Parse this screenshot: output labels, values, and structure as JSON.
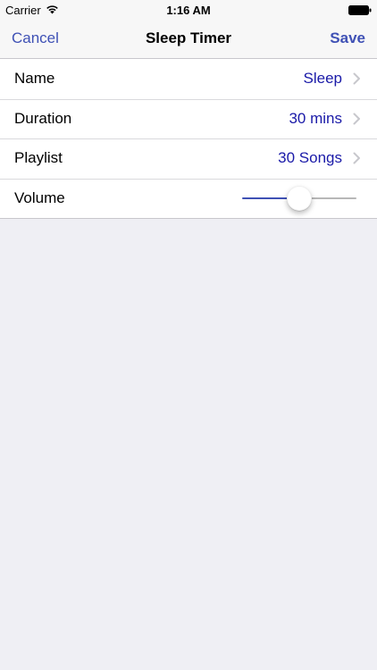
{
  "status_bar": {
    "carrier": "Carrier",
    "time": "1:16 AM",
    "wifi_icon": "wifi-icon",
    "battery_icon": "battery-icon"
  },
  "nav": {
    "cancel_label": "Cancel",
    "title": "Sleep Timer",
    "save_label": "Save",
    "tint_color": "#3f51b5"
  },
  "rows": [
    {
      "label": "Name",
      "value": "Sleep"
    },
    {
      "label": "Duration",
      "value": "30 mins"
    },
    {
      "label": "Playlist",
      "value": "30 Songs"
    },
    {
      "label": "Volume"
    }
  ],
  "volume": {
    "level": 0.5
  },
  "colors": {
    "background": "#efeff4",
    "value_text": "#1a1aa8",
    "separator": "#d9d9dd"
  }
}
